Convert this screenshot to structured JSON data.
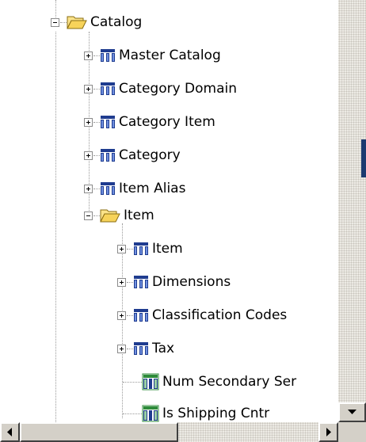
{
  "tree": {
    "items": [
      {
        "label": "Catalog",
        "icon": "folder-open-icon",
        "expander": "minus",
        "level": 1
      },
      {
        "label": "Master Catalog",
        "icon": "table-icon",
        "expander": "plus",
        "level": 2
      },
      {
        "label": "Category Domain",
        "icon": "table-icon",
        "expander": "plus",
        "level": 2
      },
      {
        "label": "Category Item",
        "icon": "table-icon",
        "expander": "plus",
        "level": 2
      },
      {
        "label": "Category",
        "icon": "table-icon",
        "expander": "plus",
        "level": 2
      },
      {
        "label": "Item Alias",
        "icon": "table-icon",
        "expander": "plus",
        "level": 2
      },
      {
        "label": "Item",
        "icon": "folder-open-icon",
        "expander": "minus",
        "level": 2
      },
      {
        "label": "Item",
        "icon": "table-icon",
        "expander": "plus",
        "level": 3
      },
      {
        "label": "Dimensions",
        "icon": "table-icon",
        "expander": "plus",
        "level": 3
      },
      {
        "label": "Classification Codes",
        "icon": "table-icon",
        "expander": "plus",
        "level": 3
      },
      {
        "label": "Tax",
        "icon": "table-icon",
        "expander": "plus",
        "level": 3
      },
      {
        "label": "Num Secondary Ser",
        "icon": "column-icon",
        "expander": "none",
        "level": 3
      },
      {
        "label": "Is Shipping Cntr",
        "icon": "column-icon",
        "expander": "none",
        "level": 3
      }
    ]
  },
  "colors": {
    "folder": "#f7d35a",
    "table_icon": "#1f3c8f",
    "column_icon": "#2e8b3a",
    "scrollbar": "#d4d0c8"
  },
  "scrollbars": {
    "vertical": {
      "up_arrow": "scroll-up-icon",
      "down_arrow": "scroll-down-icon"
    },
    "horizontal": {
      "left_arrow": "scroll-left-icon",
      "right_arrow": "scroll-right-icon"
    }
  }
}
